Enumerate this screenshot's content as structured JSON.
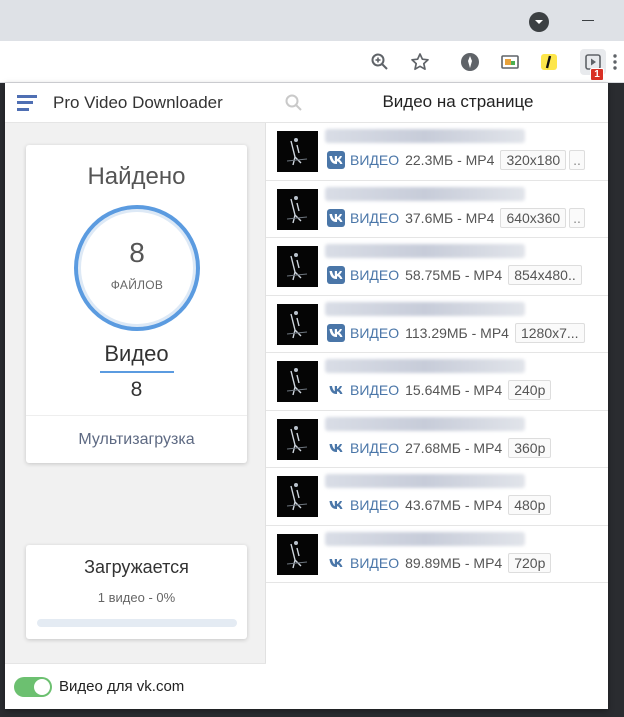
{
  "browser": {
    "toolbar_icons": [
      "zoom-icon",
      "star-icon",
      "extension-icon",
      "cast-icon",
      "yandex-icon",
      "video-download-icon"
    ],
    "badge_count": "1"
  },
  "sidebar": {
    "app_title": "Pro Video Downloader",
    "found_title": "Найдено",
    "found_count": "8",
    "found_unit": "ФАЙЛОВ",
    "type_label": "Видео",
    "type_count": "8",
    "multi_download": "Мультизагрузка",
    "downloading_title": "Загружается",
    "downloading_status": "1 видео - 0%",
    "downloading_progress": 0,
    "vk_toggle_label": "Видео для vk.com",
    "vk_toggle_on": true
  },
  "panel": {
    "title": "Видео на странице",
    "items": [
      {
        "kind": "ВИДЕО",
        "size": "22.3МБ - MP4",
        "resolution": "320x180",
        "more": "..",
        "vk_style": "filled"
      },
      {
        "kind": "ВИДЕО",
        "size": "37.6МБ - MP4",
        "resolution": "640x360",
        "more": "..",
        "vk_style": "filled"
      },
      {
        "kind": "ВИДЕО",
        "size": "58.75МБ - MP4",
        "resolution": "854x480..",
        "more": "",
        "vk_style": "filled"
      },
      {
        "kind": "ВИДЕО",
        "size": "113.29МБ - MP4",
        "resolution": "1280x7...",
        "more": "",
        "vk_style": "filled"
      },
      {
        "kind": "ВИДЕО",
        "size": "15.64МБ - MP4",
        "resolution": "240p",
        "more": "",
        "vk_style": "plain"
      },
      {
        "kind": "ВИДЕО",
        "size": "27.68МБ - MP4",
        "resolution": "360p",
        "more": "",
        "vk_style": "plain"
      },
      {
        "kind": "ВИДЕО",
        "size": "43.67МБ - MP4",
        "resolution": "480p",
        "more": "",
        "vk_style": "plain"
      },
      {
        "kind": "ВИДЕО",
        "size": "89.89МБ - MP4",
        "resolution": "720p",
        "more": "",
        "vk_style": "plain"
      }
    ]
  },
  "colors": {
    "accent": "#5b9be0",
    "vk_blue": "#4a76a8",
    "toggle_on": "#6cc070"
  }
}
